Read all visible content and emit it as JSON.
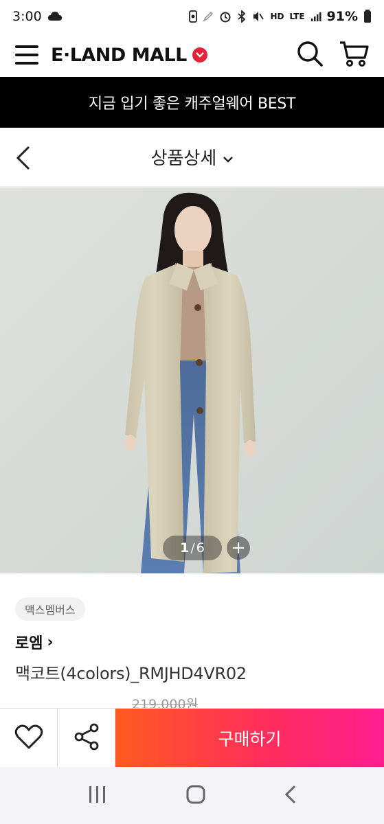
{
  "status_bar": {
    "time": "3:00",
    "battery": "91%",
    "signal_labels": [
      "HD",
      "LTE"
    ]
  },
  "header": {
    "logo_text": "E·LAND MALL",
    "icons": [
      "menu-icon",
      "search-icon",
      "cart-icon"
    ],
    "brand_color": "#e6223a"
  },
  "banner": {
    "text": "지금 입기 좋은 캐주얼웨어 BEST"
  },
  "subheader": {
    "title": "상품상세"
  },
  "gallery": {
    "current": "1",
    "separator": "/",
    "total": "6",
    "plus_label": "+"
  },
  "product": {
    "member_tag": "맥스멤버스",
    "brand": "로엠",
    "brand_chevron": "›",
    "name": "맥코트(4colors)_RMJHD4VR02",
    "original_price": "219,000원"
  },
  "actions": {
    "buy_label": "구매하기",
    "buy_gradient": [
      "#ff5a1f",
      "#ff2e5b",
      "#ff1d8f"
    ]
  },
  "nav": {
    "icons": [
      "recent-apps-icon",
      "home-icon",
      "back-nav-icon"
    ]
  }
}
